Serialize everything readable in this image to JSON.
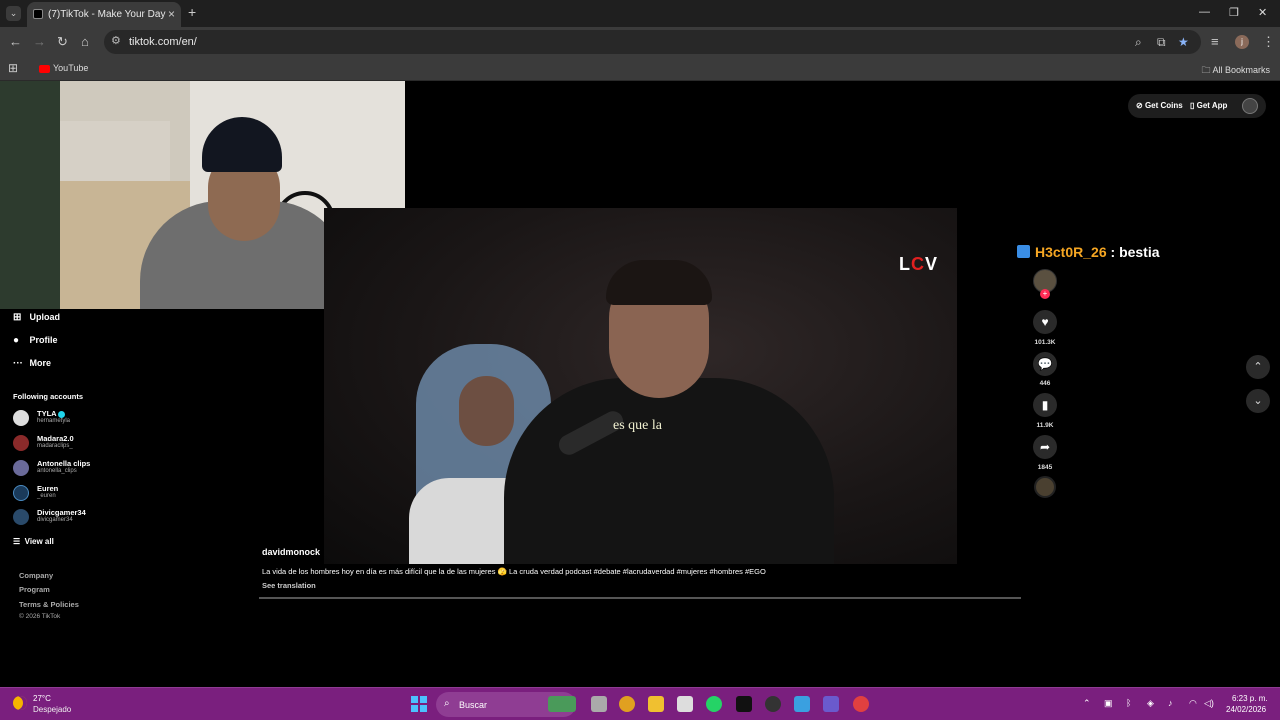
{
  "browser": {
    "tab_title": "(7)TikTok - Make Your Day",
    "url": "tiktok.com/en/",
    "bookmarks": [
      {
        "label": "YouTube"
      }
    ],
    "all_bookmarks": "All Bookmarks",
    "profile_initial": "j"
  },
  "header": {
    "get_coins": "Get Coins",
    "get_app": "Get App"
  },
  "sidebar": {
    "nav": [
      {
        "label": "Upload",
        "icon": "plus-square-icon"
      },
      {
        "label": "Profile",
        "icon": "avatar-icon"
      },
      {
        "label": "More",
        "icon": "more-icon"
      }
    ],
    "following_title": "Following accounts",
    "accounts": [
      {
        "name": "TYLA",
        "handle": "hernametyla",
        "verified": true
      },
      {
        "name": "Madara2.0",
        "handle": "madaraclips_"
      },
      {
        "name": "Antonella clips",
        "handle": "antonella_clips"
      },
      {
        "name": "Euren",
        "handle": "_euren"
      },
      {
        "name": "Divicgamer34",
        "handle": "divicgamer34"
      }
    ],
    "view_all": "View all",
    "footer": [
      "Company",
      "Program",
      "Terms & Policies"
    ],
    "copyright": "© 2026 TikTok"
  },
  "video": {
    "logo": {
      "l": "L",
      "c": "C",
      "v": "V"
    },
    "subtitle": "es que la",
    "author": "davidmonock",
    "caption": "La vida de los hombres hoy en día es más difícil que la de las mujeres 🫣 La cruda verdad podcast #debate #lacrudaverdad #mujeres #hombres #EGO",
    "see_translation": "See translation",
    "progress": 0.0
  },
  "overlay_chat": {
    "user": "H3ct0R_26",
    "separator": " : ",
    "message": "bestia"
  },
  "actions": {
    "likes": "101.3K",
    "comments": "446",
    "saves": "11.9K",
    "shares": "1845"
  },
  "taskbar": {
    "temperature": "27°C",
    "weather": "Despejado",
    "search_placeholder": "Buscar",
    "time": "6:23 p. m.",
    "date": "24/02/2026"
  },
  "colors": {
    "taskbar": "#7a1f7e",
    "chat_user": "#f5a623",
    "tiktok_red": "#fe2c55",
    "verified": "#20d5ec"
  }
}
